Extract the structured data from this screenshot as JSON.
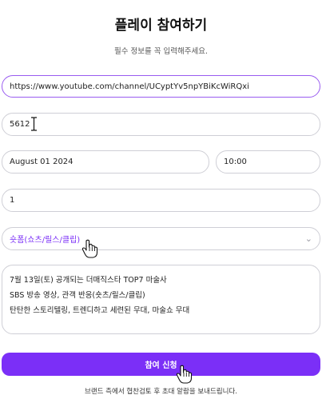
{
  "header": {
    "title": "플레이 참여하기",
    "subtitle": "필수 정보를 꼭 입력해주세요."
  },
  "form": {
    "channel_url": "https://www.youtube.com/channel/UCyptYv5npYBiKcWiRQxi",
    "number": "5612",
    "date": "August 01 2024",
    "time": "10:00",
    "count": "1",
    "content_type": "숏폼(쇼츠/릴스/클립)",
    "description_lines": [
      "7월 13일(토) 공개되는 더매직스타 TOP7 마술사",
      "SBS 방송 영상, 관객 반응(숏츠/릴스/클립)",
      "탄탄한 스토리텔링, 트렌디하고 세련된 무대, 마술쇼 무대"
    ],
    "submit_label": "참여 신청",
    "footnote": "브랜드 측에서 협찬검토 후 초대 알람을 보내드립니다."
  },
  "colors": {
    "accent": "#7b2ff7",
    "focus_border": "#9a5cf0",
    "field_border": "#cfcfd6"
  },
  "icons": {
    "dropdown": "chevron-down-icon",
    "text_cursor": "i-beam-cursor-icon",
    "pointer": "hand-pointer-icon"
  }
}
